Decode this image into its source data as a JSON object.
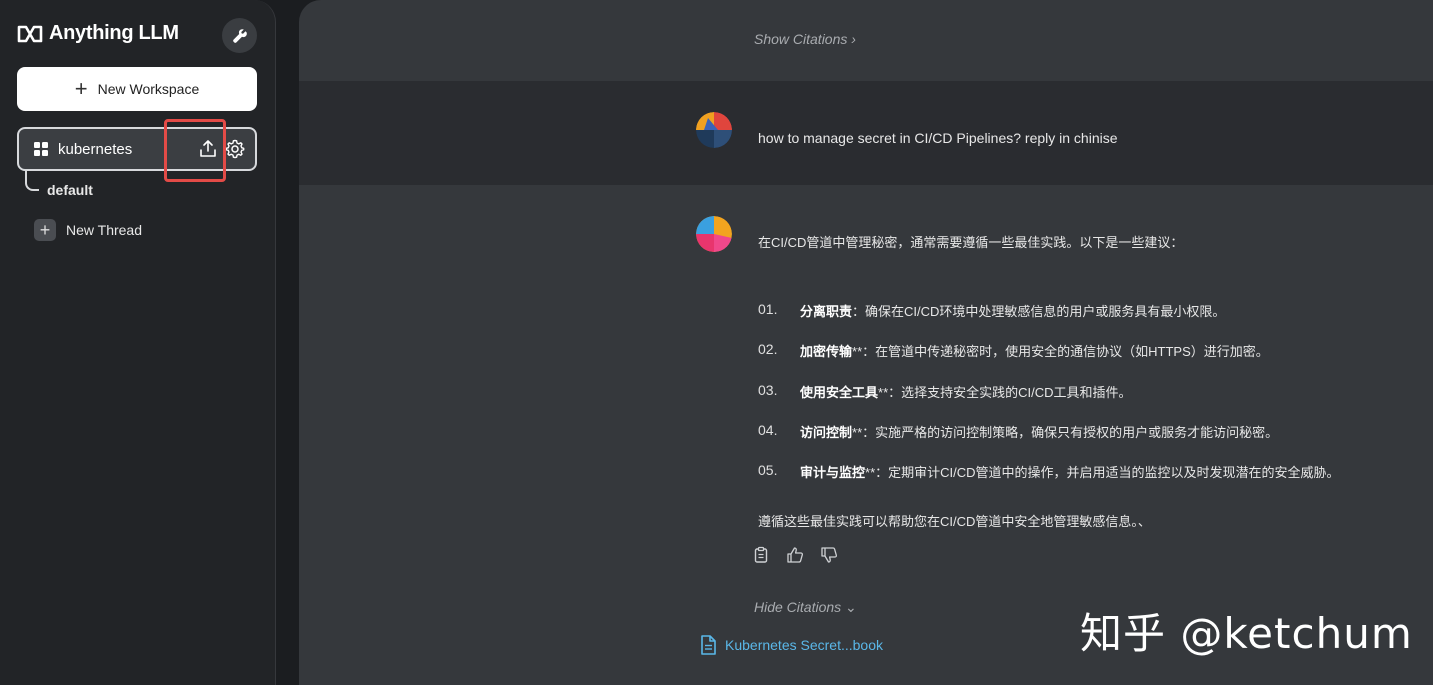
{
  "app": {
    "brand_name": "Anything LLM",
    "brand_icon": "infinity-logo-icon",
    "settings_icon": "wrench-icon"
  },
  "sidebar": {
    "new_workspace_label": "New Workspace",
    "workspace": {
      "name": "kubernetes",
      "icon": "grid-icon",
      "actions": [
        "upload-icon",
        "gear-icon"
      ]
    },
    "threads": [
      {
        "label": "default"
      }
    ],
    "new_thread_label": "New Thread"
  },
  "chat": {
    "show_citations": "Show Citations",
    "user_message": "how to manage secret in CI/CD Pipelines? reply in chinise",
    "assistant": {
      "intro": "在CI/CD管道中管理秘密，通常需要遵循一些最佳实践。以下是一些建议：",
      "items": [
        {
          "num": "01.",
          "title": "分离职责",
          "text": "：确保在CI/CD环境中处理敏感信息的用户或服务具有最小权限。"
        },
        {
          "num": "02.",
          "title": "加密传输",
          "text": "**：在管道中传递秘密时，使用安全的通信协议（如HTTPS）进行加密。"
        },
        {
          "num": "03.",
          "title": "使用安全工具",
          "text": "**：选择支持安全实践的CI/CD工具和插件。"
        },
        {
          "num": "04.",
          "title": "访问控制",
          "text": "**：实施严格的访问控制策略，确保只有授权的用户或服务才能访问秘密。"
        },
        {
          "num": "05.",
          "title": "审计与监控",
          "text": "**：定期审计CI/CD管道中的操作，并启用适当的监控以及时发现潜在的安全威胁。"
        }
      ],
      "conclusion": "遵循这些最佳实践可以帮助您在CI/CD管道中安全地管理敏感信息。、",
      "action_icons": [
        "clipboard-icon",
        "thumbs-up-icon",
        "thumbs-down-icon"
      ]
    },
    "hide_citations": "Hide Citations",
    "citation_doc": "Kubernetes Secret...book"
  },
  "watermark": "知乎 @ketchum",
  "colors": {
    "highlight": "#e34b47",
    "link": "#5ab7e8"
  }
}
